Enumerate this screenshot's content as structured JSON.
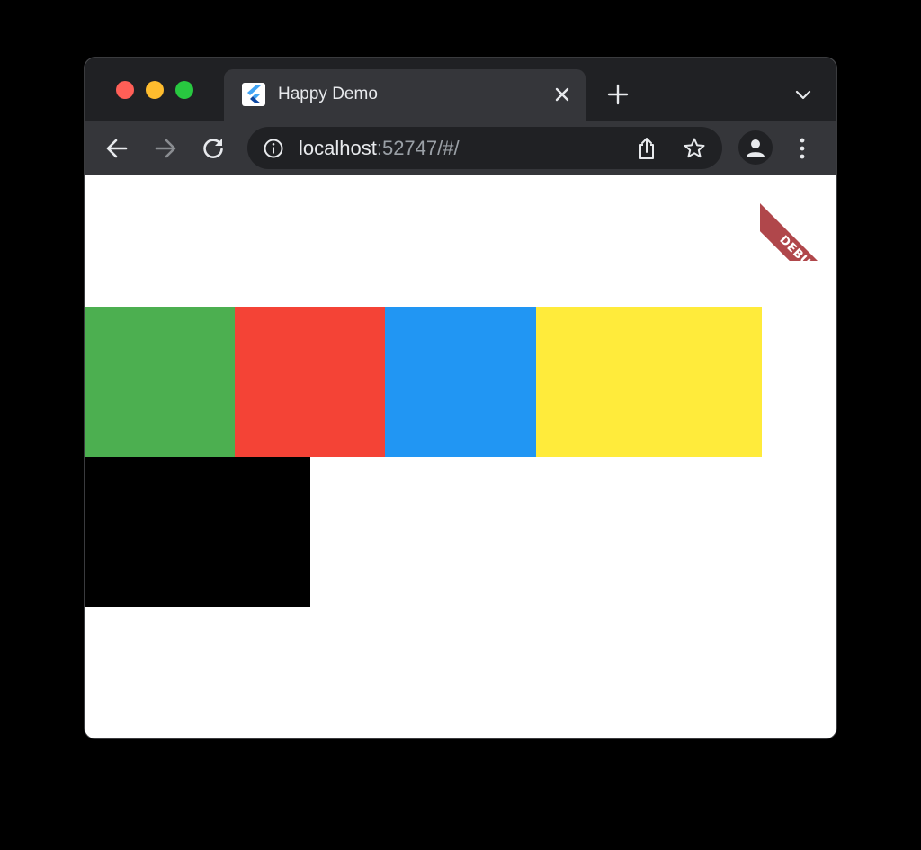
{
  "browser": {
    "tab": {
      "title": "Happy Demo",
      "favicon": "flutter-icon"
    },
    "address_bar": {
      "host": "localhost",
      "rest": ":52747/#/"
    },
    "icons": {
      "close": "close-icon",
      "new_tab": "plus-icon",
      "tab_search": "chevron-down-icon",
      "back": "back-arrow-icon",
      "forward": "forward-arrow-icon",
      "reload": "reload-icon",
      "info": "info-icon",
      "share": "share-icon",
      "bookmark": "star-icon",
      "profile": "avatar-icon",
      "menu": "more-vert-icon"
    },
    "colors": {
      "titlebar": "#202124",
      "toolbar": "#35363a",
      "omnibox": "#202124"
    }
  },
  "app": {
    "debug_banner": "DEBUG",
    "boxes": [
      {
        "name": "green",
        "color": "#4caf50"
      },
      {
        "name": "red",
        "color": "#f44336"
      },
      {
        "name": "blue",
        "color": "#2196f3"
      },
      {
        "name": "yellow",
        "color": "#ffeb3b"
      },
      {
        "name": "black",
        "color": "#000000"
      }
    ]
  }
}
